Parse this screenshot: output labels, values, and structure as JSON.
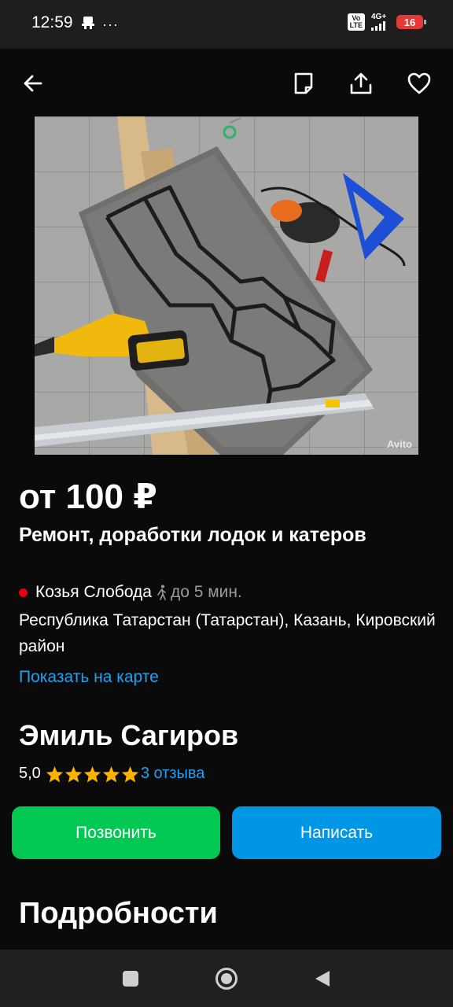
{
  "status_bar": {
    "time": "12:59",
    "more": "···",
    "volte": "Vo\nLTE",
    "network": "4G+",
    "battery": "16"
  },
  "toolbar": {
    "back_icon": "arrow-left-icon",
    "note_icon": "note-icon",
    "share_icon": "share-icon",
    "favorite_icon": "heart-icon"
  },
  "photo": {
    "watermark": "Avito"
  },
  "listing": {
    "price": "от 100 ₽",
    "title": "Ремонт, доработки лодок и катеров",
    "metro_station": "Козья Слобода",
    "metro_color": "#e3000f",
    "walk_time": "до 5 мин.",
    "address": "Республика Татарстан (Татарстан), Казань, Кировский район",
    "map_link": "Показать на карте"
  },
  "seller": {
    "name": "Эмиль Сагиров",
    "rating": "5,0",
    "stars": 5,
    "reviews": "3 отзыва"
  },
  "actions": {
    "call": "Позвонить",
    "message": "Написать"
  },
  "details": {
    "title": "Подробности"
  },
  "colors": {
    "accent_blue": "#1ea1f2",
    "call_green": "#00c853",
    "message_blue": "#0096e6",
    "star": "#ffb300"
  }
}
